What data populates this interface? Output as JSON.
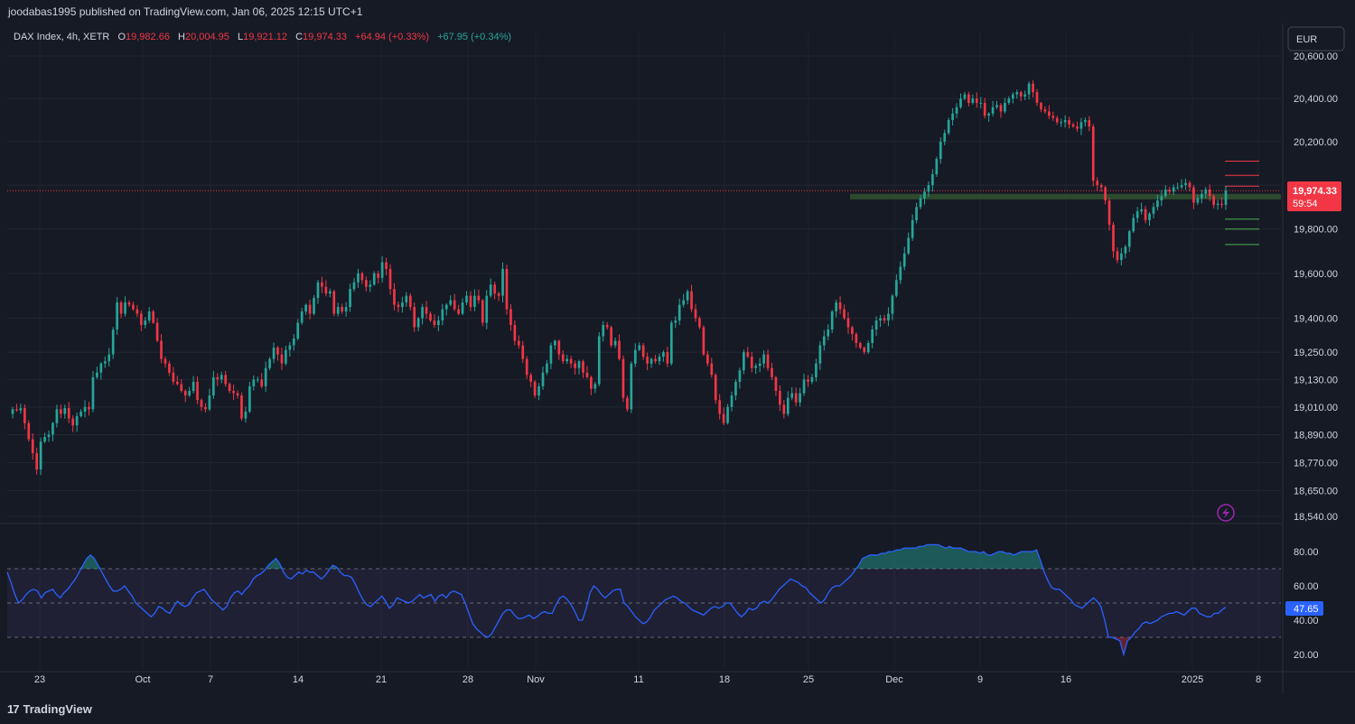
{
  "header": {
    "publisher_line": "joodabas1995 published on TradingView.com, Jan 06, 2025 12:15 UTC+1"
  },
  "legend": {
    "symbol": "DAX Index, 4h, XETR",
    "o_label": "O",
    "o_value": "19,982.66",
    "h_label": "H",
    "h_value": "20,004.95",
    "l_label": "L",
    "l_value": "19,921.12",
    "c_label": "C",
    "c_value": "19,974.33",
    "change": "+64.94 (+0.33%)",
    "change2": "+67.95 (+0.34%)"
  },
  "currency_button": "EUR",
  "price_badge": {
    "price": "19,974.33",
    "countdown": "59:54"
  },
  "rsi_badge": "47.65",
  "footer": {
    "brand": "TradingView"
  },
  "colors": {
    "background": "#161a25",
    "up": "#26a69a",
    "down": "#f23645",
    "rsi_line": "#2962ff",
    "rsi_band": "#7e57c2",
    "support_zone": "#2e4d2e"
  },
  "icons": {
    "lightning": "lightning-icon",
    "logo": "tradingview-logo-icon"
  },
  "chart_data": [
    {
      "type": "candlestick",
      "title": "DAX Index, 4h, XETR",
      "y_axis": {
        "scale": "log",
        "ticks": [
          20600,
          20400,
          20200,
          20000,
          19800,
          19600,
          19400,
          19250,
          19130,
          19010,
          18890,
          18770,
          18650,
          18540
        ],
        "tick_labels": [
          "20,600.00",
          "20,400.00",
          "20,200.00",
          "20,000.00",
          "19,800.00",
          "19,600.00",
          "19,400.00",
          "19,250.00",
          "19,130.00",
          "19,010.00",
          "18,890.00",
          "18,770.00",
          "18,650.00",
          "18,540.00"
        ],
        "range": [
          18540,
          20640
        ]
      },
      "x_axis": {
        "tick_labels": [
          "23",
          "Oct",
          "7",
          "14",
          "21",
          "28",
          "Nov",
          "11",
          "18",
          "25",
          "Dec",
          "9",
          "16",
          "2025",
          "8"
        ],
        "range_bars": [
          0,
          313
        ]
      },
      "last_price": 19974.33,
      "support_zone": [
        19935,
        19960
      ],
      "levels_red": [
        20110,
        20045,
        19995
      ],
      "levels_green": [
        19845,
        19800,
        19730
      ],
      "closes": [
        19000,
        18995,
        19005,
        18940,
        18870,
        18810,
        18740,
        18860,
        18880,
        18890,
        18940,
        19000,
        18980,
        19005,
        18960,
        18930,
        18970,
        18990,
        19010,
        19000,
        19140,
        19160,
        19200,
        19210,
        19240,
        19350,
        19470,
        19420,
        19470,
        19460,
        19440,
        19420,
        19370,
        19390,
        19430,
        19380,
        19300,
        19220,
        19200,
        19160,
        19120,
        19110,
        19080,
        19060,
        19080,
        19120,
        19040,
        19010,
        19000,
        19060,
        19140,
        19130,
        19150,
        19110,
        19080,
        19070,
        19060,
        18960,
        18990,
        19100,
        19130,
        19130,
        19100,
        19180,
        19220,
        19270,
        19240,
        19200,
        19260,
        19280,
        19310,
        19380,
        19430,
        19460,
        19420,
        19490,
        19560,
        19540,
        19510,
        19520,
        19420,
        19450,
        19430,
        19450,
        19530,
        19560,
        19600,
        19570,
        19540,
        19550,
        19600,
        19580,
        19650,
        19620,
        19530,
        19460,
        19450,
        19470,
        19500,
        19450,
        19360,
        19400,
        19450,
        19420,
        19390,
        19370,
        19390,
        19440,
        19460,
        19480,
        19440,
        19420,
        19470,
        19500,
        19450,
        19500,
        19480,
        19380,
        19500,
        19550,
        19510,
        19500,
        19620,
        19440,
        19370,
        19300,
        19280,
        19220,
        19150,
        19120,
        19060,
        19100,
        19160,
        19200,
        19280,
        19300,
        19240,
        19210,
        19220,
        19200,
        19180,
        19210,
        19160,
        19140,
        19090,
        19110,
        19320,
        19370,
        19360,
        19280,
        19300,
        19220,
        19050,
        19000,
        19200,
        19260,
        19280,
        19230,
        19200,
        19220,
        19210,
        19230,
        19250,
        19200,
        19380,
        19390,
        19460,
        19480,
        19520,
        19440,
        19400,
        19360,
        19240,
        19200,
        19150,
        19040,
        18980,
        18940,
        19010,
        19060,
        19120,
        19170,
        19250,
        19230,
        19180,
        19190,
        19200,
        19240,
        19180,
        19140,
        19080,
        19020,
        18980,
        19050,
        19070,
        19030,
        19070,
        19130,
        19120,
        19140,
        19200,
        19280,
        19320,
        19350,
        19430,
        19470,
        19440,
        19400,
        19360,
        19330,
        19290,
        19270,
        19250,
        19290,
        19350,
        19390,
        19400,
        19390,
        19420,
        19500,
        19570,
        19630,
        19690,
        19760,
        19840,
        19900,
        19940,
        19970,
        20000,
        20050,
        20120,
        20200,
        20240,
        20300,
        20330,
        20360,
        20400,
        20420,
        20380,
        20400,
        20380,
        20380,
        20320,
        20330,
        20360,
        20370,
        20340,
        20380,
        20400,
        20420,
        20430,
        20410,
        20420,
        20470,
        20430,
        20380,
        20350,
        20340,
        20320,
        20310,
        20290,
        20290,
        20300,
        20280,
        20270,
        20260,
        20290,
        20300,
        20270,
        20020,
        20000,
        19990,
        19930,
        19820,
        19700,
        19660,
        19690,
        19720,
        19790,
        19850,
        19880,
        19890,
        19840,
        19870,
        19900,
        19930,
        19950,
        19980,
        19970,
        19990,
        19990,
        20000,
        20010,
        19990,
        19920,
        19940,
        19960,
        19980,
        19950,
        19910,
        19915,
        19910,
        19974.33
      ]
    },
    {
      "type": "line",
      "title": "RSI",
      "y_axis": {
        "ticks": [
          80,
          60,
          40,
          20
        ],
        "tick_labels": [
          "80.00",
          "60.00",
          "40.00",
          "20.00"
        ],
        "range": [
          14,
          87
        ]
      },
      "bands": {
        "upper": 70,
        "middle": 50,
        "lower": 30
      },
      "last_value": 47.65,
      "values": [
        68,
        62,
        55,
        50,
        52,
        55,
        57,
        58,
        57,
        53,
        56,
        57,
        58,
        55,
        53,
        56,
        58,
        61,
        64,
        68,
        72,
        76,
        78,
        76,
        72,
        68,
        64,
        60,
        57,
        57,
        58,
        60,
        57,
        54,
        50,
        48,
        46,
        44,
        42,
        44,
        48,
        47,
        45,
        44,
        48,
        51,
        49,
        48,
        49,
        53,
        56,
        57,
        58,
        55,
        52,
        50,
        48,
        46,
        48,
        53,
        56,
        57,
        55,
        58,
        60,
        64,
        66,
        67,
        69,
        72,
        74,
        76,
        73,
        68,
        65,
        64,
        66,
        68,
        67,
        69,
        68,
        68,
        66,
        64,
        66,
        69,
        72,
        71,
        68,
        66,
        66,
        65,
        61,
        56,
        52,
        49,
        48,
        50,
        52,
        54,
        51,
        47,
        49,
        53,
        52,
        51,
        50,
        51,
        53,
        55,
        53,
        54,
        55,
        51,
        54,
        55,
        53,
        56,
        57,
        56,
        55,
        50,
        44,
        38,
        35,
        33,
        31,
        30,
        32,
        36,
        40,
        44,
        46,
        46,
        43,
        41,
        41,
        42,
        43,
        41,
        42,
        44,
        45,
        44,
        44,
        49,
        53,
        54,
        52,
        49,
        45,
        40,
        40,
        47,
        56,
        60,
        58,
        55,
        53,
        55,
        57,
        58,
        58,
        50,
        48,
        45,
        42,
        40,
        38,
        39,
        42,
        46,
        48,
        50,
        52,
        53,
        54,
        53,
        51,
        50,
        48,
        46,
        45,
        44,
        43,
        45,
        47,
        48,
        47,
        48,
        50,
        50,
        47,
        44,
        42,
        44,
        47,
        46,
        47,
        50,
        51,
        50,
        52,
        55,
        58,
        60,
        62,
        64,
        63,
        62,
        60,
        59,
        56,
        54,
        52,
        50,
        52,
        56,
        59,
        60,
        60,
        62,
        64,
        66,
        69,
        72,
        76,
        77,
        78,
        78,
        78,
        79,
        79,
        80,
        80,
        81,
        81,
        82,
        82,
        82,
        82,
        83,
        83,
        84,
        84,
        84,
        84,
        83,
        82,
        83,
        82,
        82,
        82,
        81,
        80,
        80,
        80,
        79,
        80,
        78,
        78,
        79,
        80,
        80,
        79,
        79,
        78,
        79,
        80,
        80,
        80,
        80,
        81,
        75,
        68,
        63,
        59,
        58,
        58,
        56,
        54,
        52,
        49,
        48,
        47,
        49,
        51,
        53,
        51,
        48,
        40,
        30,
        30,
        29,
        28,
        20,
        28,
        30,
        33,
        35,
        38,
        39,
        38,
        39,
        40,
        42,
        43,
        44,
        44,
        45,
        44,
        43,
        45,
        47,
        47,
        44,
        43,
        42,
        42,
        44,
        44,
        46,
        47.65
      ]
    }
  ]
}
